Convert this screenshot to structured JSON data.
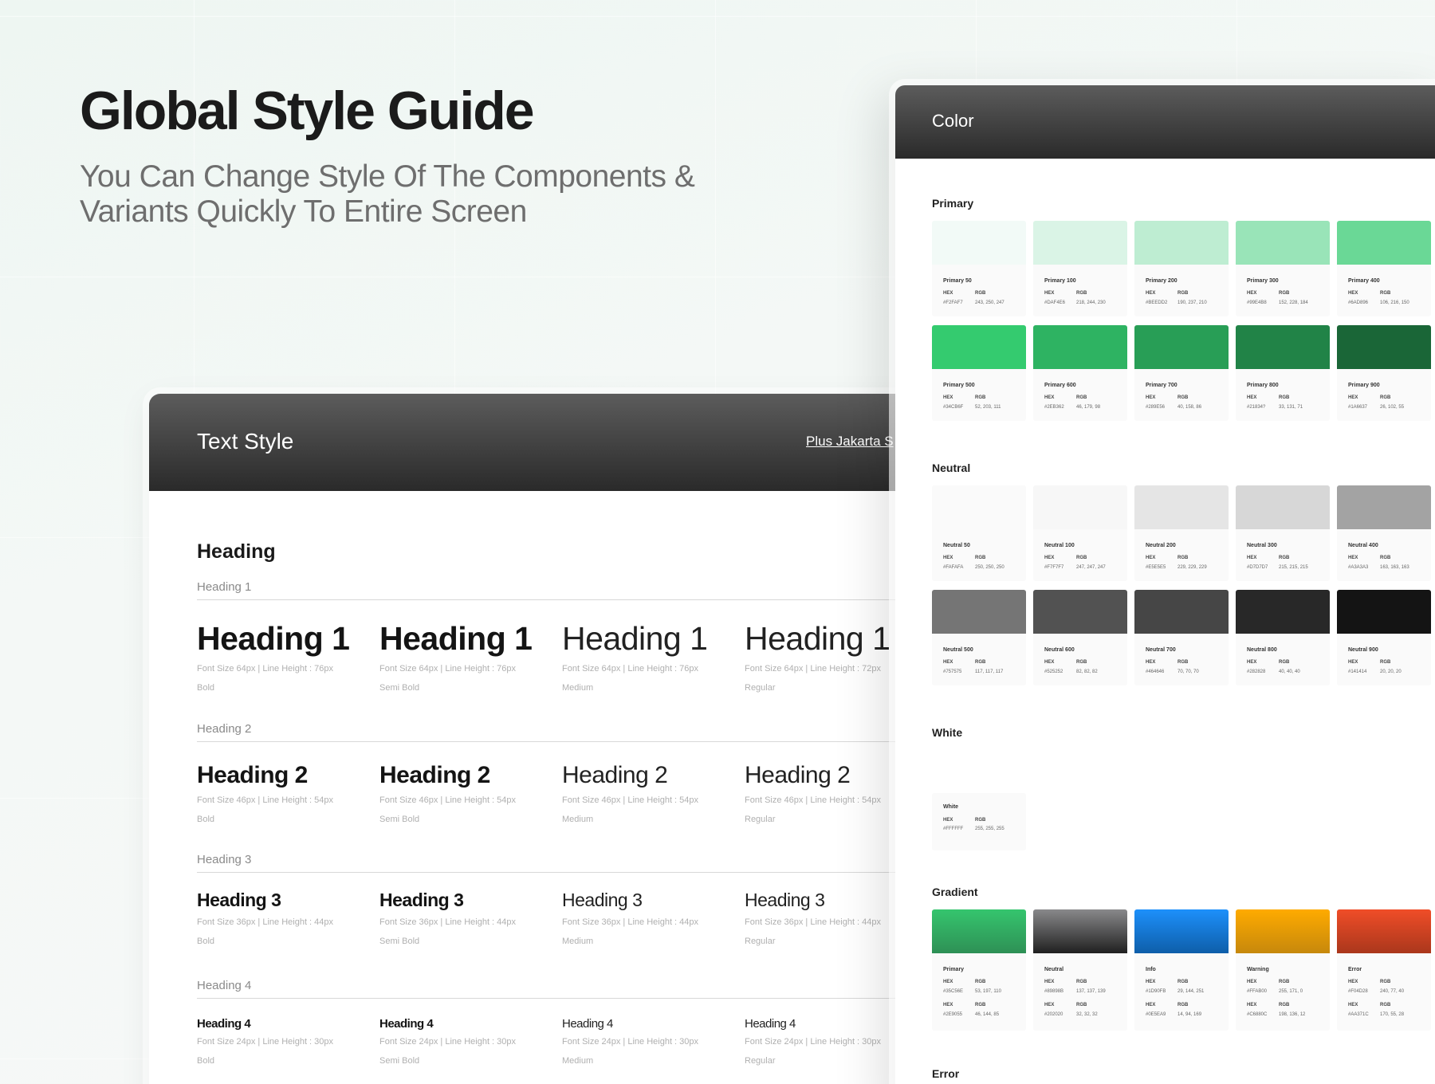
{
  "hero": {
    "title": "Global Style Guide",
    "subtitle": "You Can Change Style Of The Components & Variants Quickly To Entire Screen"
  },
  "text_style": {
    "title": "Text Style",
    "font_link": "Plus Jakarta S",
    "section": "Heading",
    "groups": [
      {
        "label": "Heading 1",
        "items": [
          {
            "sample": "Heading 1",
            "meta": "Font Size 64px | Line Height : 76px",
            "weight": "Bold"
          },
          {
            "sample": "Heading 1",
            "meta": "Font Size 64px | Line Height : 76px",
            "weight": "Semi Bold"
          },
          {
            "sample": "Heading 1",
            "meta": "Font Size 64px | Line Height : 76px",
            "weight": "Medium"
          },
          {
            "sample": "Heading 1",
            "meta": "Font Size 64px | Line Height : 72px",
            "weight": "Regular"
          }
        ]
      },
      {
        "label": "Heading 2",
        "items": [
          {
            "sample": "Heading 2",
            "meta": "Font Size 46px | Line Height : 54px",
            "weight": "Bold"
          },
          {
            "sample": "Heading 2",
            "meta": "Font Size 46px | Line Height : 54px",
            "weight": "Semi Bold"
          },
          {
            "sample": "Heading 2",
            "meta": "Font Size 46px | Line Height : 54px",
            "weight": "Medium"
          },
          {
            "sample": "Heading 2",
            "meta": "Font Size 46px | Line Height : 54px",
            "weight": "Regular"
          }
        ]
      },
      {
        "label": "Heading 3",
        "items": [
          {
            "sample": "Heading 3",
            "meta": "Font Size 36px | Line Height : 44px",
            "weight": "Bold"
          },
          {
            "sample": "Heading 3",
            "meta": "Font Size 36px | Line Height : 44px",
            "weight": "Semi Bold"
          },
          {
            "sample": "Heading 3",
            "meta": "Font Size 36px | Line Height : 44px",
            "weight": "Medium"
          },
          {
            "sample": "Heading 3",
            "meta": "Font Size 36px | Line Height : 44px",
            "weight": "Regular"
          }
        ]
      },
      {
        "label": "Heading 4",
        "items": [
          {
            "sample": "Heading 4",
            "meta": "Font Size 24px | Line Height : 30px",
            "weight": "Bold"
          },
          {
            "sample": "Heading 4",
            "meta": "Font Size 24px | Line Height : 30px",
            "weight": "Semi Bold"
          },
          {
            "sample": "Heading 4",
            "meta": "Font Size 24px | Line Height : 30px",
            "weight": "Medium"
          },
          {
            "sample": "Heading 4",
            "meta": "Font Size 24px | Line Height : 30px",
            "weight": "Regular"
          }
        ]
      }
    ]
  },
  "color": {
    "title": "Color",
    "hex_label": "HEX",
    "rgb_label": "RGB",
    "primary": {
      "label": "Primary",
      "swatches": [
        {
          "name": "Primary 50",
          "hex": "#F2FAF7",
          "rgb": "243, 250, 247",
          "color": "#F2FAF7"
        },
        {
          "name": "Primary 100",
          "hex": "#DAF4E6",
          "rgb": "218, 244, 230",
          "color": "#DAF4E6"
        },
        {
          "name": "Primary 200",
          "hex": "#BEEDD2",
          "rgb": "190, 237, 210",
          "color": "#BEEDD2"
        },
        {
          "name": "Primary 300",
          "hex": "#99E4B8",
          "rgb": "152, 228, 184",
          "color": "#99E4B8"
        },
        {
          "name": "Primary 400",
          "hex": "#6AD896",
          "rgb": "106, 216, 150",
          "color": "#6AD896"
        },
        {
          "name": "Primary 500",
          "hex": "#34CB6F",
          "rgb": "52, 203, 111",
          "color": "#34CB6F"
        },
        {
          "name": "Primary 600",
          "hex": "#2EB362",
          "rgb": "46, 179, 98",
          "color": "#2EB362"
        },
        {
          "name": "Primary 700",
          "hex": "#289E56",
          "rgb": "40, 158, 86",
          "color": "#289E56"
        },
        {
          "name": "Primary 800",
          "hex": "#21834?",
          "rgb": "33, 131, 71",
          "color": "#218347"
        },
        {
          "name": "Primary 900",
          "hex": "#1A6637",
          "rgb": "26, 102, 55",
          "color": "#1A6637"
        }
      ]
    },
    "neutral": {
      "label": "Neutral",
      "swatches": [
        {
          "name": "Neutral 50",
          "hex": "#FAFAFA",
          "rgb": "250, 250, 250",
          "color": "#FAFAFA"
        },
        {
          "name": "Neutral 100",
          "hex": "#F7F7F7",
          "rgb": "247, 247, 247",
          "color": "#F7F7F7"
        },
        {
          "name": "Neutral 200",
          "hex": "#E5E5E5",
          "rgb": "229, 229, 229",
          "color": "#E5E5E5"
        },
        {
          "name": "Neutral 300",
          "hex": "#D7D7D7",
          "rgb": "215, 215, 215",
          "color": "#D7D7D7"
        },
        {
          "name": "Neutral 400",
          "hex": "#A3A3A3",
          "rgb": "163, 163, 163",
          "color": "#A3A3A3"
        },
        {
          "name": "Neutral 500",
          "hex": "#757575",
          "rgb": "117, 117, 117",
          "color": "#757575"
        },
        {
          "name": "Neutral 600",
          "hex": "#525252",
          "rgb": "82, 82, 82",
          "color": "#525252"
        },
        {
          "name": "Neutral 700",
          "hex": "#464646",
          "rgb": "70, 70, 70",
          "color": "#464646"
        },
        {
          "name": "Neutral 800",
          "hex": "#282828",
          "rgb": "40, 40, 40",
          "color": "#282828"
        },
        {
          "name": "Neutral 900",
          "hex": "#141414",
          "rgb": "20, 20, 20",
          "color": "#141414"
        }
      ]
    },
    "white": {
      "label": "White",
      "swatch": {
        "name": "White",
        "hex": "#FFFFFF",
        "rgb": "255, 255, 255",
        "color": "#FFFFFF"
      }
    },
    "gradient": {
      "label": "Gradient",
      "swatches": [
        {
          "name": "Primary",
          "hex1": "#35C56E",
          "rgb1": "53, 197, 110",
          "hex2": "#2E9055",
          "rgb2": "46, 144, 85",
          "from": "#35C56E",
          "to": "#2E9055"
        },
        {
          "name": "Neutral",
          "hex1": "#89898B",
          "rgb1": "137, 137, 139",
          "hex2": "#202020",
          "rgb2": "32, 32, 32",
          "from": "#89898B",
          "to": "#202020"
        },
        {
          "name": "Info",
          "hex1": "#1D90FB",
          "rgb1": "29, 144, 251",
          "hex2": "#0E5EA9",
          "rgb2": "14, 94, 169",
          "from": "#1D90FB",
          "to": "#0E5EA9"
        },
        {
          "name": "Warning",
          "hex1": "#FFAB00",
          "rgb1": "255, 171, 0",
          "hex2": "#C6880C",
          "rgb2": "198, 136, 12",
          "from": "#FFAB00",
          "to": "#C6880C"
        },
        {
          "name": "Error",
          "hex1": "#F04D28",
          "rgb1": "240, 77, 40",
          "hex2": "#AA371C",
          "rgb2": "170, 55, 28",
          "from": "#F04D28",
          "to": "#AA371C"
        }
      ]
    },
    "error": {
      "label": "Error"
    }
  }
}
